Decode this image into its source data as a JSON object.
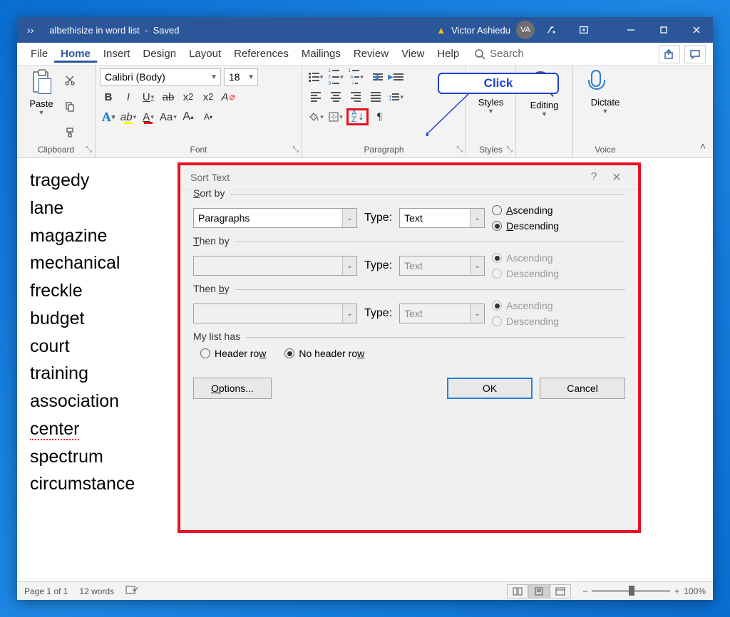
{
  "titlebar": {
    "doc_title": "albethisize in word list",
    "save_state": "Saved",
    "user_name": "Victor Ashiedu",
    "user_initials": "VA"
  },
  "menu": {
    "file": "File",
    "home": "Home",
    "insert": "Insert",
    "design": "Design",
    "layout": "Layout",
    "references": "References",
    "mailings": "Mailings",
    "review": "Review",
    "view": "View",
    "help": "Help",
    "search": "Search"
  },
  "ribbon": {
    "clipboard_label": "Clipboard",
    "paste_label": "Paste",
    "font_label": "Font",
    "font_name": "Calibri (Body)",
    "font_size": "18",
    "paragraph_label": "Paragraph",
    "styles_label": "Styles",
    "styles_btn": "Styles",
    "editing_label": "Editing",
    "editing_btn": "Editing",
    "voice_label": "Voice",
    "dictate_btn": "Dictate"
  },
  "callout": {
    "text": "Click"
  },
  "document": {
    "words": [
      "tragedy",
      "lane",
      "magazine",
      "mechanical",
      "freckle",
      "budget",
      "court",
      "training",
      "association",
      "center",
      "spectrum",
      "circumstance"
    ]
  },
  "dialog": {
    "title": "Sort Text",
    "sort_by_label": "Sort by",
    "sort_by_field": "Paragraphs",
    "type_label": "Type:",
    "type_value": "Text",
    "ascending": "Ascending",
    "descending": "Descending",
    "then_by_label": "Then by",
    "then_by_label2": "Then by",
    "list_has_label": "My list has",
    "header_row": "Header row",
    "no_header_row": "No header row",
    "options_btn": "Options...",
    "ok_btn": "OK",
    "cancel_btn": "Cancel"
  },
  "status": {
    "page": "Page 1 of 1",
    "words": "12 words",
    "zoom": "100%"
  }
}
